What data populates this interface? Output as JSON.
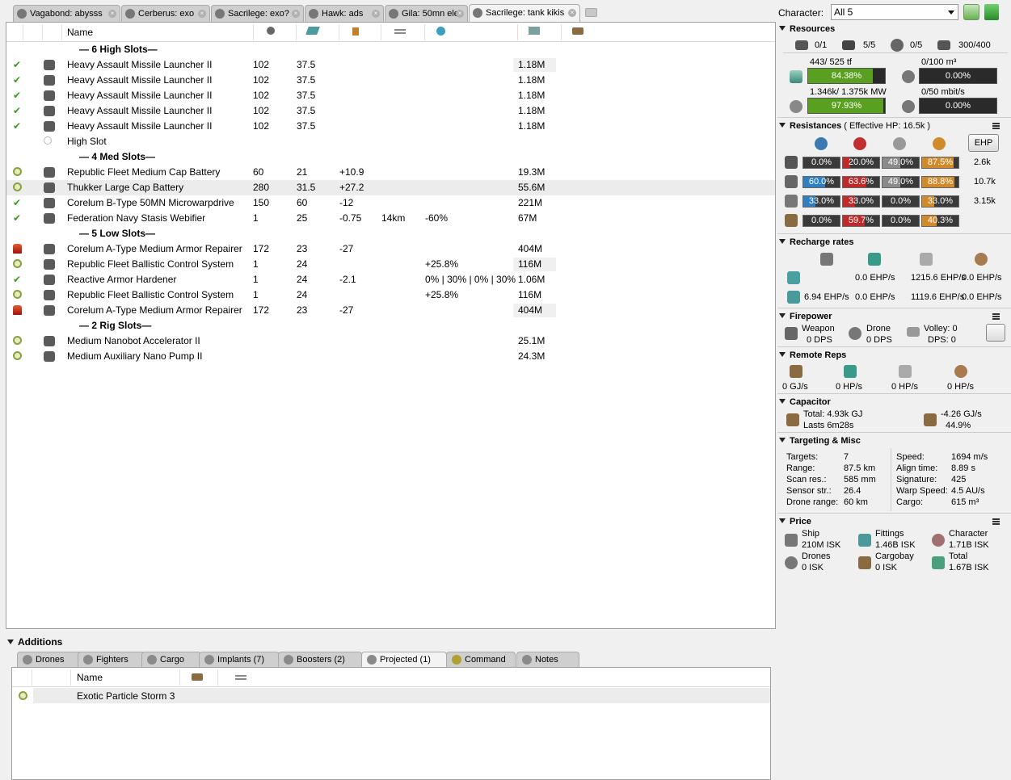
{
  "tabs": [
    {
      "label": "Vagabond: abysss",
      "icon": "ship-icon"
    },
    {
      "label": "Cerberus: exo",
      "icon": "ship-icon"
    },
    {
      "label": "Sacrilege: exo?",
      "icon": "ship-icon"
    },
    {
      "label": "Hawk: ads",
      "icon": "ship-icon"
    },
    {
      "label": "Gila: 50mn ele",
      "icon": "ship-icon"
    },
    {
      "label": "Sacrilege: tank kikis",
      "icon": "ship-icon",
      "active": true
    }
  ],
  "fitting": {
    "header": {
      "name": "Name"
    },
    "rows": [
      {
        "kind": "header",
        "label": "— 6 High Slots—"
      },
      {
        "kind": "mod",
        "state": "check",
        "name": "Heavy Assault Missile Launcher II",
        "c1": "102",
        "c2": "37.5",
        "c3": "",
        "c4": "",
        "c5": "",
        "price": "1.18M",
        "pricebg": true
      },
      {
        "kind": "mod",
        "state": "check",
        "name": "Heavy Assault Missile Launcher II",
        "c1": "102",
        "c2": "37.5",
        "c3": "",
        "c4": "",
        "c5": "",
        "price": "1.18M"
      },
      {
        "kind": "mod",
        "state": "check",
        "name": "Heavy Assault Missile Launcher II",
        "c1": "102",
        "c2": "37.5",
        "c3": "",
        "c4": "",
        "c5": "",
        "price": "1.18M"
      },
      {
        "kind": "mod",
        "state": "check",
        "name": "Heavy Assault Missile Launcher II",
        "c1": "102",
        "c2": "37.5",
        "c3": "",
        "c4": "",
        "c5": "",
        "price": "1.18M"
      },
      {
        "kind": "mod",
        "state": "check",
        "name": "Heavy Assault Missile Launcher II",
        "c1": "102",
        "c2": "37.5",
        "c3": "",
        "c4": "",
        "c5": "",
        "price": "1.18M"
      },
      {
        "kind": "mod",
        "state": "",
        "name": "High Slot",
        "c1": "",
        "c2": "",
        "c3": "",
        "c4": "",
        "c5": "",
        "price": ""
      },
      {
        "kind": "header",
        "label": "— 4 Med Slots—"
      },
      {
        "kind": "mod",
        "state": "ring",
        "name": "Republic Fleet Medium Cap Battery",
        "c1": "60",
        "c2": "21",
        "c3": "+10.9",
        "c4": "",
        "c5": "",
        "price": "19.3M"
      },
      {
        "kind": "mod",
        "state": "ring",
        "name": "Thukker Large Cap Battery",
        "c1": "280",
        "c2": "31.5",
        "c3": "+27.2",
        "c4": "",
        "c5": "",
        "price": "55.6M",
        "selected": true
      },
      {
        "kind": "mod",
        "state": "check",
        "name": "Corelum B-Type 50MN Microwarpdrive",
        "c1": "150",
        "c2": "60",
        "c3": "-12",
        "c4": "",
        "c5": "",
        "price": "221M"
      },
      {
        "kind": "mod",
        "state": "check",
        "name": "Federation Navy Stasis Webifier",
        "c1": "1",
        "c2": "25",
        "c3": "-0.75",
        "c4": "14km",
        "c5": "-60%",
        "price": "67M"
      },
      {
        "kind": "header",
        "label": "— 5 Low Slots—"
      },
      {
        "kind": "mod",
        "state": "fire",
        "name": "Corelum A-Type Medium Armor Repairer",
        "c1": "172",
        "c2": "23",
        "c3": "-27",
        "c4": "",
        "c5": "",
        "price": "404M"
      },
      {
        "kind": "mod",
        "state": "ring",
        "name": "Republic Fleet Ballistic Control System",
        "c1": "1",
        "c2": "24",
        "c3": "",
        "c4": "",
        "c5": "+25.8%",
        "price": "116M",
        "pricebg": true
      },
      {
        "kind": "mod",
        "state": "check",
        "name": "Reactive Armor Hardener",
        "c1": "1",
        "c2": "24",
        "c3": "-2.1",
        "c4": "",
        "c5": "0% | 30% | 0% | 30%",
        "price": "1.06M"
      },
      {
        "kind": "mod",
        "state": "ring",
        "name": "Republic Fleet Ballistic Control System",
        "c1": "1",
        "c2": "24",
        "c3": "",
        "c4": "",
        "c5": "+25.8%",
        "price": "116M"
      },
      {
        "kind": "mod",
        "state": "fire",
        "name": "Corelum A-Type Medium Armor Repairer",
        "c1": "172",
        "c2": "23",
        "c3": "-27",
        "c4": "",
        "c5": "",
        "price": "404M",
        "pricebg": true
      },
      {
        "kind": "header",
        "label": "— 2 Rig Slots—"
      },
      {
        "kind": "mod",
        "state": "ring",
        "name": "Medium Nanobot Accelerator II",
        "c1": "",
        "c2": "",
        "c3": "",
        "c4": "",
        "c5": "",
        "price": "25.1M"
      },
      {
        "kind": "mod",
        "state": "ring",
        "name": "Medium Auxiliary Nano Pump II",
        "c1": "",
        "c2": "",
        "c3": "",
        "c4": "",
        "c5": "",
        "price": "24.3M"
      }
    ]
  },
  "additions": {
    "title": "Additions",
    "tabs": [
      {
        "label": "Drones"
      },
      {
        "label": "Fighters"
      },
      {
        "label": "Cargo"
      },
      {
        "label": "Implants (7)"
      },
      {
        "label": "Boosters (2)"
      },
      {
        "label": "Projected (1)",
        "active": true
      },
      {
        "label": "Command"
      },
      {
        "label": "Notes"
      }
    ],
    "name_header": "Name",
    "rows": [
      {
        "name": "Exotic Particle Storm 3"
      }
    ]
  },
  "character": {
    "label": "Character:",
    "value": "All 5"
  },
  "resources": {
    "title": "Resources",
    "hardpoints": [
      "0/1",
      "5/5",
      "0/5",
      "300/400"
    ],
    "cpu": {
      "label": "443/ 525 tf",
      "percent": "84.38%",
      "fraction": 0.8438
    },
    "pg": {
      "label": "1.346k/ 1.375k MW",
      "percent": "97.93%",
      "fraction": 0.9793
    },
    "dronebay": {
      "label": "0/100 m³",
      "percent": "0.00%",
      "fraction": 0
    },
    "bandwidth": {
      "label": "0/50 mbit/s",
      "percent": "0.00%",
      "fraction": 0
    }
  },
  "resistances": {
    "title": "Resistances",
    "ehp_label": "( Effective HP: 16.5k )",
    "ehp_button": "EHP",
    "rows": [
      {
        "values": [
          "0.0%",
          "20.0%",
          "49.0%",
          "87.5%"
        ],
        "fractions": [
          0,
          0.2,
          0.49,
          0.875
        ],
        "ehp": "2.6k"
      },
      {
        "values": [
          "60.0%",
          "63.6%",
          "49.0%",
          "88.8%"
        ],
        "fractions": [
          0.6,
          0.636,
          0.49,
          0.888
        ],
        "ehp": "10.7k"
      },
      {
        "values": [
          "33.0%",
          "33.0%",
          "0.0%",
          "33.0%"
        ],
        "fractions": [
          0.33,
          0.33,
          0,
          0.33
        ],
        "ehp": "3.15k"
      },
      {
        "values": [
          "0.0%",
          "59.7%",
          "0.0%",
          "40.3%"
        ],
        "fractions": [
          0,
          0.597,
          0,
          0.403
        ],
        "ehp": ""
      }
    ],
    "colors": [
      "#2f7fc0",
      "#c02a2a",
      "#8a8a8a",
      "#d08a2a"
    ]
  },
  "recharge": {
    "title": "Recharge rates",
    "row1": [
      "0.0 EHP/s",
      "1215.6 EHP/s",
      "0.0 EHP/s"
    ],
    "row2": [
      "6.94 EHP/s",
      "0.0 EHP/s",
      "1119.6 EHP/s",
      "0.0 EHP/s"
    ]
  },
  "firepower": {
    "title": "Firepower",
    "weapon_label": "Weapon",
    "weapon_value": "0 DPS",
    "drone_label": "Drone",
    "drone_value": "0 DPS",
    "volley": "Volley: 0",
    "dps": "DPS: 0"
  },
  "remote_reps": {
    "title": "Remote Reps",
    "values": [
      "0 GJ/s",
      "0 HP/s",
      "0 HP/s",
      "0 HP/s"
    ]
  },
  "capacitor": {
    "title": "Capacitor",
    "total": "Total: 4.93k GJ",
    "lasts": "Lasts 6m28s",
    "rate": "-4.26 GJ/s",
    "percent": "44.9%"
  },
  "targeting": {
    "title": "Targeting & Misc",
    "left": [
      [
        "Targets:",
        "7"
      ],
      [
        "Range:",
        "87.5 km"
      ],
      [
        "Scan res.:",
        "585 mm"
      ],
      [
        "Sensor str.:",
        "26.4"
      ],
      [
        "Drone range:",
        "60 km"
      ]
    ],
    "right": [
      [
        "Speed:",
        "1694 m/s"
      ],
      [
        "Align time:",
        "8.89 s"
      ],
      [
        "Signature:",
        "425"
      ],
      [
        "Warp Speed:",
        "4.5 AU/s"
      ],
      [
        "Cargo:",
        "615 m³"
      ]
    ]
  },
  "price": {
    "title": "Price",
    "items": [
      {
        "label": "Ship",
        "value": "210M ISK"
      },
      {
        "label": "Fittings",
        "value": "1.46B ISK"
      },
      {
        "label": "Character",
        "value": "1.71B ISK"
      },
      {
        "label": "Drones",
        "value": "0 ISK"
      },
      {
        "label": "Cargobay",
        "value": "0 ISK"
      },
      {
        "label": "Total",
        "value": "1.67B ISK"
      }
    ]
  }
}
